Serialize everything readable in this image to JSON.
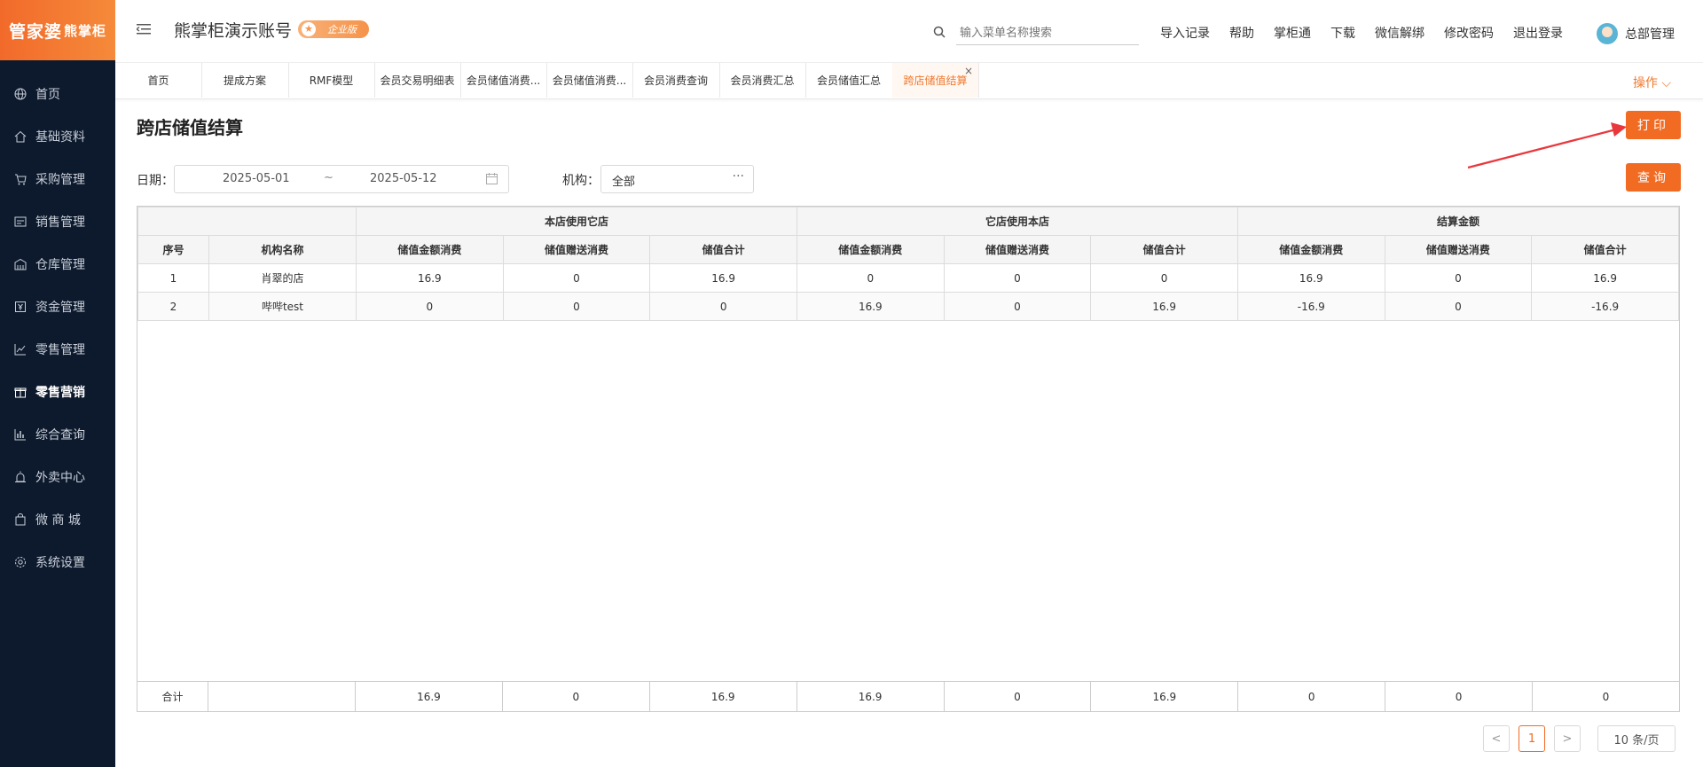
{
  "brand": {
    "logo_main": "管家婆",
    "logo_sub": "熊掌柜"
  },
  "sidebar": {
    "items": [
      {
        "label": "首页",
        "icon": "globe-icon"
      },
      {
        "label": "基础资料",
        "icon": "home-icon"
      },
      {
        "label": "采购管理",
        "icon": "cart-icon"
      },
      {
        "label": "销售管理",
        "icon": "sales-icon"
      },
      {
        "label": "仓库管理",
        "icon": "warehouse-icon"
      },
      {
        "label": "资金管理",
        "icon": "money-icon"
      },
      {
        "label": "零售管理",
        "icon": "chart-icon"
      },
      {
        "label": "零售营销",
        "icon": "gift-icon"
      },
      {
        "label": "综合查询",
        "icon": "bar-chart-icon"
      },
      {
        "label": "外卖中心",
        "icon": "alarm-icon"
      },
      {
        "label": "微 商 城",
        "icon": "bag-icon"
      },
      {
        "label": "系统设置",
        "icon": "settings-icon"
      }
    ],
    "active_index": 7
  },
  "header": {
    "account_title": "熊掌柜演示账号",
    "edition_badge": "企业版",
    "search_placeholder": "输入菜单名称搜索",
    "links": [
      "导入记录",
      "帮助",
      "掌柜通",
      "下载",
      "微信解绑",
      "修改密码",
      "退出登录"
    ],
    "user_name": "总部管理"
  },
  "tabs": {
    "items": [
      "首页",
      "提成方案",
      "RMF模型",
      "会员交易明细表",
      "会员储值消费...",
      "会员储值消费...",
      "会员消费查询",
      "会员消费汇总",
      "会员储值汇总",
      "跨店储值结算"
    ],
    "active_index": 9,
    "close_symbol": "×",
    "operations_label": "操作 ⌵"
  },
  "page": {
    "title": "跨店储值结算",
    "print_button": "打印",
    "query_button": "查询"
  },
  "filters": {
    "date_label": "日期：",
    "date_start": "2025-05-01",
    "date_sep": "~",
    "date_end": "2025-05-12",
    "org_label": "机构：",
    "org_value": "全部",
    "org_more": "···"
  },
  "table": {
    "group_headers": [
      "本店使用它店",
      "它店使用本店",
      "结算金额"
    ],
    "columns": [
      "序号",
      "机构名称",
      "储值金额消费",
      "储值赠送消费",
      "储值合计",
      "储值金额消费",
      "储值赠送消费",
      "储值合计",
      "储值金额消费",
      "储值赠送消费",
      "储值合计"
    ],
    "rows": [
      [
        "1",
        "肖翠的店",
        "16.9",
        "0",
        "16.9",
        "0",
        "0",
        "0",
        "16.9",
        "0",
        "16.9"
      ],
      [
        "2",
        "哔哔test",
        "0",
        "0",
        "0",
        "16.9",
        "0",
        "16.9",
        "-16.9",
        "0",
        "-16.9"
      ]
    ],
    "footer": [
      "合计",
      "",
      "16.9",
      "0",
      "16.9",
      "16.9",
      "0",
      "16.9",
      "0",
      "0",
      "0"
    ]
  },
  "pagination": {
    "prev": "<",
    "current": "1",
    "next": ">",
    "page_size": "10 条/页"
  },
  "colors": {
    "accent": "#f26b22",
    "sidebar_bg": "#0d1a2d",
    "annotation_arrow": "#e8383d"
  }
}
